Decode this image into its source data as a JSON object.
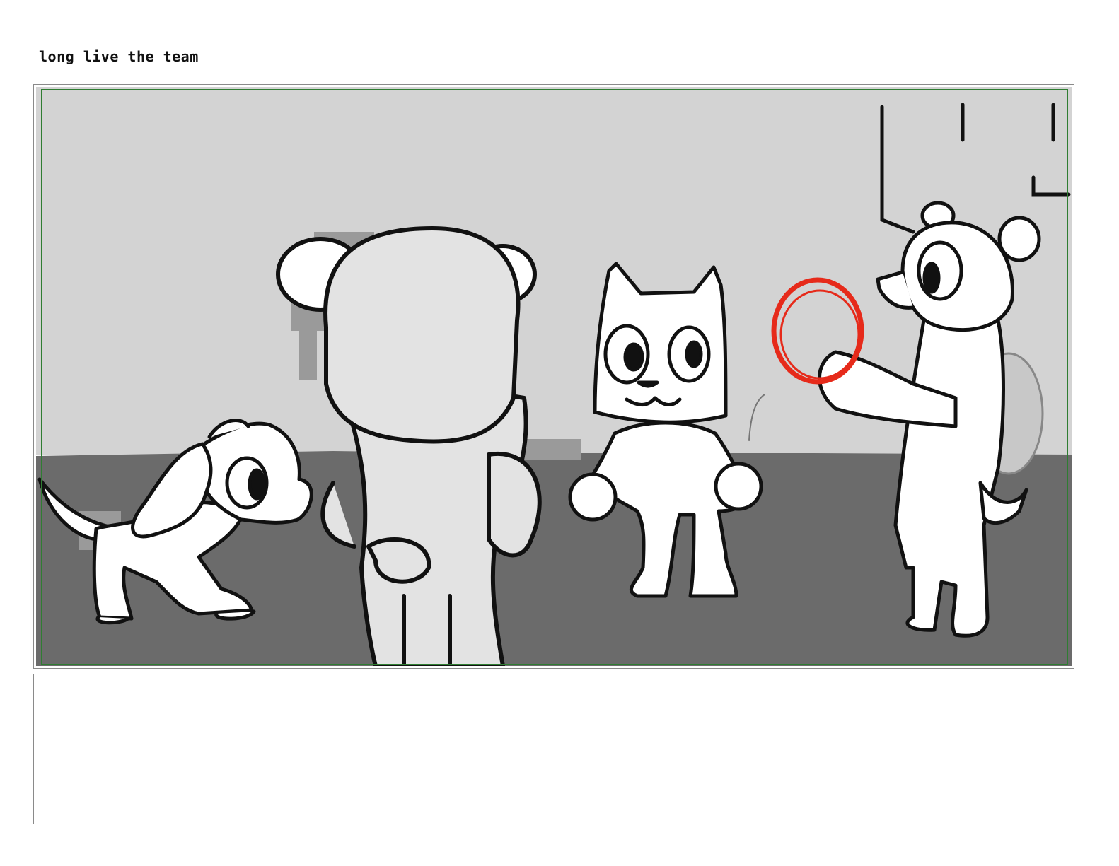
{
  "board": {
    "title": "long live the team",
    "notes": ""
  },
  "panel": {
    "characters": [
      "puppy",
      "bear-back-view",
      "cat",
      "bear-with-disc"
    ],
    "highlight_color": "#e62a1a",
    "frame_color": "#2f7d32",
    "wall_color": "#d3d3d3",
    "floor_color": "#6b6b6b"
  }
}
